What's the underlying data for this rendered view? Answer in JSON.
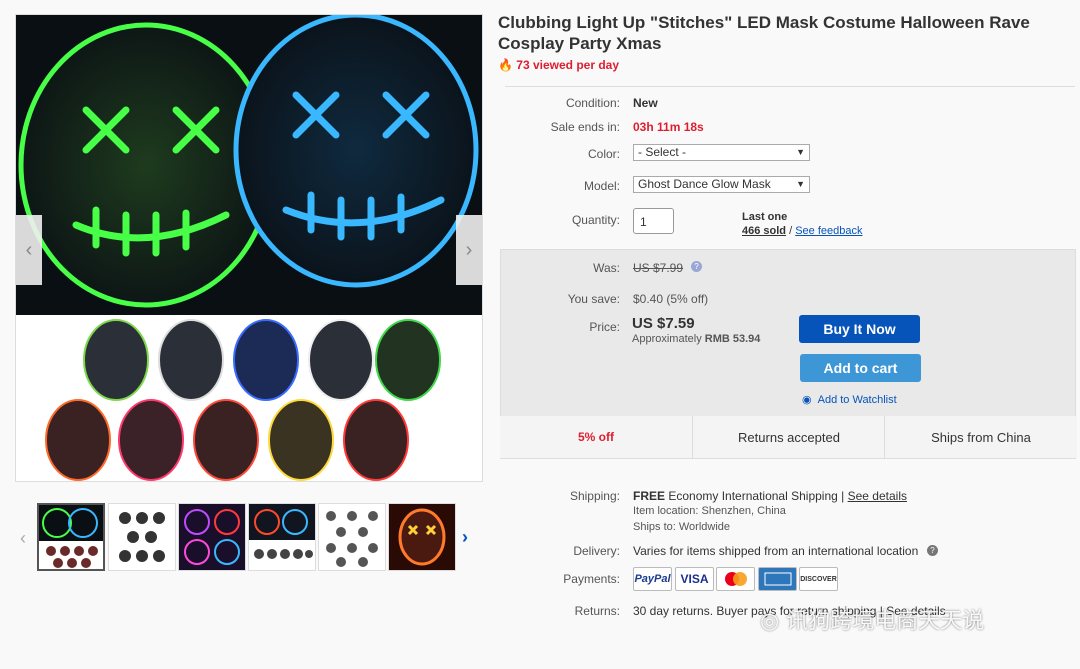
{
  "product": {
    "title": "Clubbing Light Up \"Stitches\" LED Mask Costume Halloween Rave Cosplay Party Xmas",
    "views": "73 viewed per day"
  },
  "details": {
    "condition_label": "Condition:",
    "condition_value": "New",
    "sale_label": "Sale ends in:",
    "sale_value": "03h 11m 18s",
    "color_label": "Color:",
    "color_value": "- Select -",
    "model_label": "Model:",
    "model_value": "Ghost Dance Glow Mask",
    "quantity_label": "Quantity:",
    "quantity_value": "1",
    "last_one": "Last one",
    "sold": "466 sold",
    "sep": "/",
    "feedback": "See feedback"
  },
  "pricing": {
    "was_label": "Was:",
    "was_value": "US $7.99",
    "save_label": "You save:",
    "save_value": "$0.40 (5% off)",
    "price_label": "Price:",
    "price_value": "US $7.59",
    "approx_prefix": "Approximately",
    "approx_value": "RMB 53.94",
    "buy_now": "Buy It Now",
    "add_cart": "Add to cart",
    "watchlist": "Add to Watchlist",
    "accent_blue": "#0654ba",
    "cart_blue": "#3d96d6"
  },
  "features": [
    "5% off",
    "Returns accepted",
    "Ships from China"
  ],
  "shipping": {
    "label": "Shipping:",
    "free": "FREE",
    "method": "Economy International Shipping |",
    "details_link": "See details",
    "location_label": "Item location:",
    "location": "Shenzhen, China",
    "ships_label": "Ships to:",
    "ships_to": "Worldwide"
  },
  "delivery": {
    "label": "Delivery:",
    "value": "Varies for items shipped from an international location"
  },
  "payments": {
    "label": "Payments:",
    "methods": [
      "PayPal",
      "VISA",
      "MasterCard",
      "AMEX",
      "DISCOVER"
    ]
  },
  "returns": {
    "label": "Returns:",
    "value": "30 day returns. Buyer pays for return shipping | See details"
  },
  "watermark": "讯狗跨境电商天天说"
}
